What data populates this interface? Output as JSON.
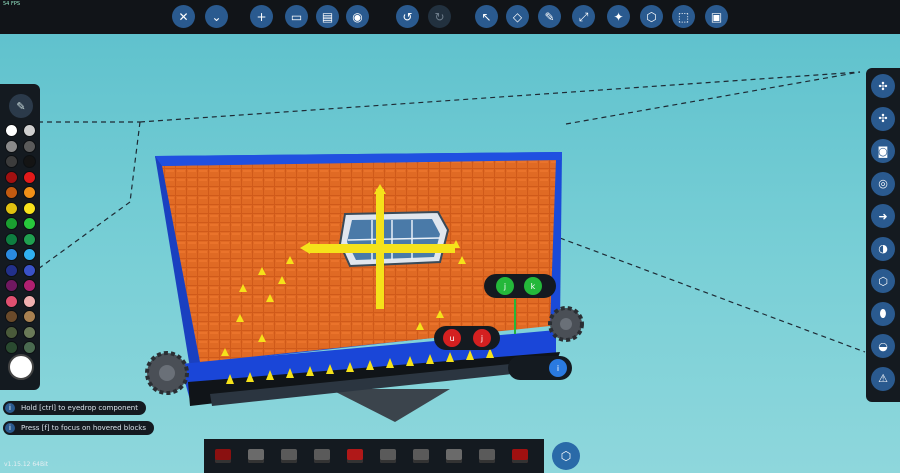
{
  "fps_text": "54 FPS",
  "version": "v1.15.12 64Bit",
  "hints": [
    {
      "text": "Hold [ctrl] to eyedrop component"
    },
    {
      "text": "Press [f] to focus on hovered blocks"
    }
  ],
  "top_toolbar": [
    {
      "name": "close-icon",
      "glyph": "✕"
    },
    {
      "name": "chevron-down-icon",
      "glyph": "⌄"
    },
    {
      "name": "add-icon",
      "glyph": "+"
    },
    {
      "name": "folder-icon",
      "glyph": "▭"
    },
    {
      "name": "save-icon",
      "glyph": "▤"
    },
    {
      "name": "steam-icon",
      "glyph": "◉"
    },
    {
      "name": "undo-icon",
      "glyph": "↺"
    },
    {
      "name": "redo-icon",
      "glyph": "↻"
    },
    {
      "name": "cursor-icon",
      "glyph": "↖"
    },
    {
      "name": "eraser-icon",
      "glyph": "◇"
    },
    {
      "name": "paint-brush-icon",
      "glyph": "✎"
    },
    {
      "name": "resize-icon",
      "glyph": "⤢"
    },
    {
      "name": "light-bulb-icon",
      "glyph": "✦"
    },
    {
      "name": "logic-icon",
      "glyph": "⬡"
    },
    {
      "name": "select-box-icon",
      "glyph": "⬚"
    },
    {
      "name": "fullscreen-icon",
      "glyph": "▣"
    }
  ],
  "palette": {
    "colors": [
      "#ffffff",
      "#cfcfcf",
      "#8a8a8a",
      "#5a5a5a",
      "#3c3c3c",
      "#141414",
      "#a01010",
      "#e21a1a",
      "#c25a10",
      "#f09018",
      "#e0c010",
      "#f8e21c",
      "#1a9e30",
      "#28c83c",
      "#0e7e40",
      "#20a050",
      "#2a8ae0",
      "#30b0f0",
      "#22308a",
      "#3a52c8",
      "#701860",
      "#b02070",
      "#e05070",
      "#f0b0b0",
      "#6a4a2a",
      "#a88050",
      "#4a5a3a",
      "#6a7a58",
      "#2a4a30",
      "#4a6a50"
    ]
  },
  "right_toolbar": [
    {
      "name": "wind-north-icon",
      "glyph": "✣"
    },
    {
      "name": "wind-icon",
      "glyph": "✣"
    },
    {
      "name": "camera-icon",
      "glyph": "◙"
    },
    {
      "name": "center-of-mass-icon",
      "glyph": "◎"
    },
    {
      "name": "flow-icon",
      "glyph": "➜"
    },
    {
      "name": "buoyancy-icon",
      "glyph": "◑"
    },
    {
      "name": "cube-icon",
      "glyph": "⬡"
    },
    {
      "name": "hover-icon",
      "glyph": "⬮"
    },
    {
      "name": "ball-icon",
      "glyph": "◒"
    },
    {
      "name": "warning-icon",
      "glyph": "⚠"
    }
  ],
  "hotbar": [
    {
      "name": "hotbar-slot-1",
      "color": "#8a1010"
    },
    {
      "name": "hotbar-slot-2",
      "color": "#6a6a6a"
    },
    {
      "name": "hotbar-slot-3",
      "color": "#5a5a5a"
    },
    {
      "name": "hotbar-slot-4",
      "color": "#5a5a5a"
    },
    {
      "name": "hotbar-slot-5",
      "color": "#b01818"
    },
    {
      "name": "hotbar-slot-6",
      "color": "#5a5a5a"
    },
    {
      "name": "hotbar-slot-7",
      "color": "#5a5a5a"
    },
    {
      "name": "hotbar-slot-8",
      "color": "#6a6a6a"
    },
    {
      "name": "hotbar-slot-9",
      "color": "#5a5a5a"
    },
    {
      "name": "hotbar-slot-10",
      "color": "#a01010"
    }
  ],
  "scene": {
    "wall_color": "#d05a1a",
    "frame_color": "#1a4ad8",
    "marker_color": "#f5e21a",
    "node_labels": [
      {
        "name": "green-node-left",
        "text": "j"
      },
      {
        "name": "green-node-right",
        "text": "k"
      },
      {
        "name": "red-node-left",
        "text": "u"
      },
      {
        "name": "red-node-right",
        "text": "j"
      },
      {
        "name": "blue-node",
        "text": "i"
      }
    ]
  }
}
